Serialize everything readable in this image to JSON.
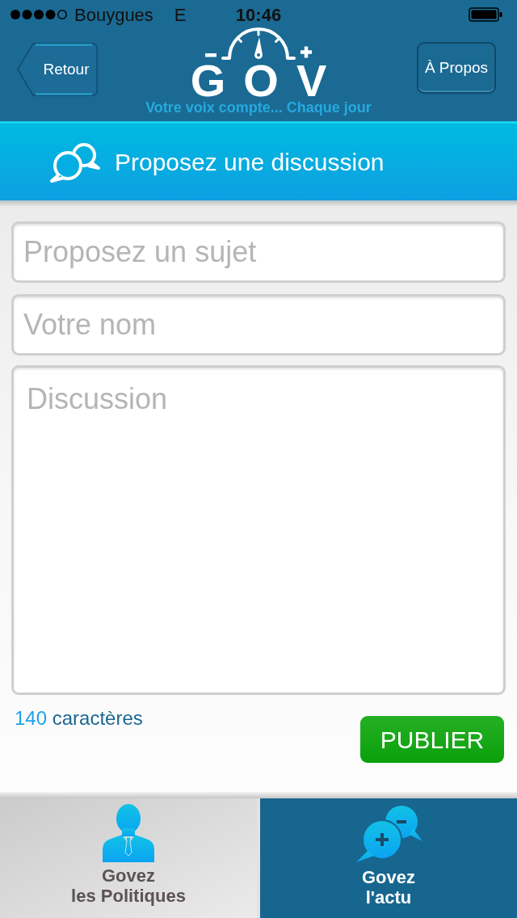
{
  "status_bar": {
    "carrier": "Bouygues",
    "network": "E",
    "time": "10:46"
  },
  "nav_bar": {
    "back_button": "Retour",
    "logo": {
      "wordmark": "GOV",
      "tagline": "Votre voix compte... Chaque jour"
    },
    "about_button": "À Propos"
  },
  "section_header": {
    "title": "Proposez une discussion"
  },
  "form": {
    "fields": [
      {
        "kind": "input",
        "placeholder": "Proposez un sujet"
      },
      {
        "kind": "input",
        "placeholder": "Votre nom"
      },
      {
        "kind": "textarea",
        "placeholder": "Discussion"
      }
    ],
    "counter": {
      "count": "140",
      "label": "caractères"
    },
    "submit_button": "PUBLIER"
  },
  "tab_bar": [
    {
      "label_lines": [
        "Govez",
        "les Politiques"
      ],
      "selected": false
    },
    {
      "label_lines": [
        "Govez",
        "l'actu"
      ],
      "selected": true
    }
  ]
}
